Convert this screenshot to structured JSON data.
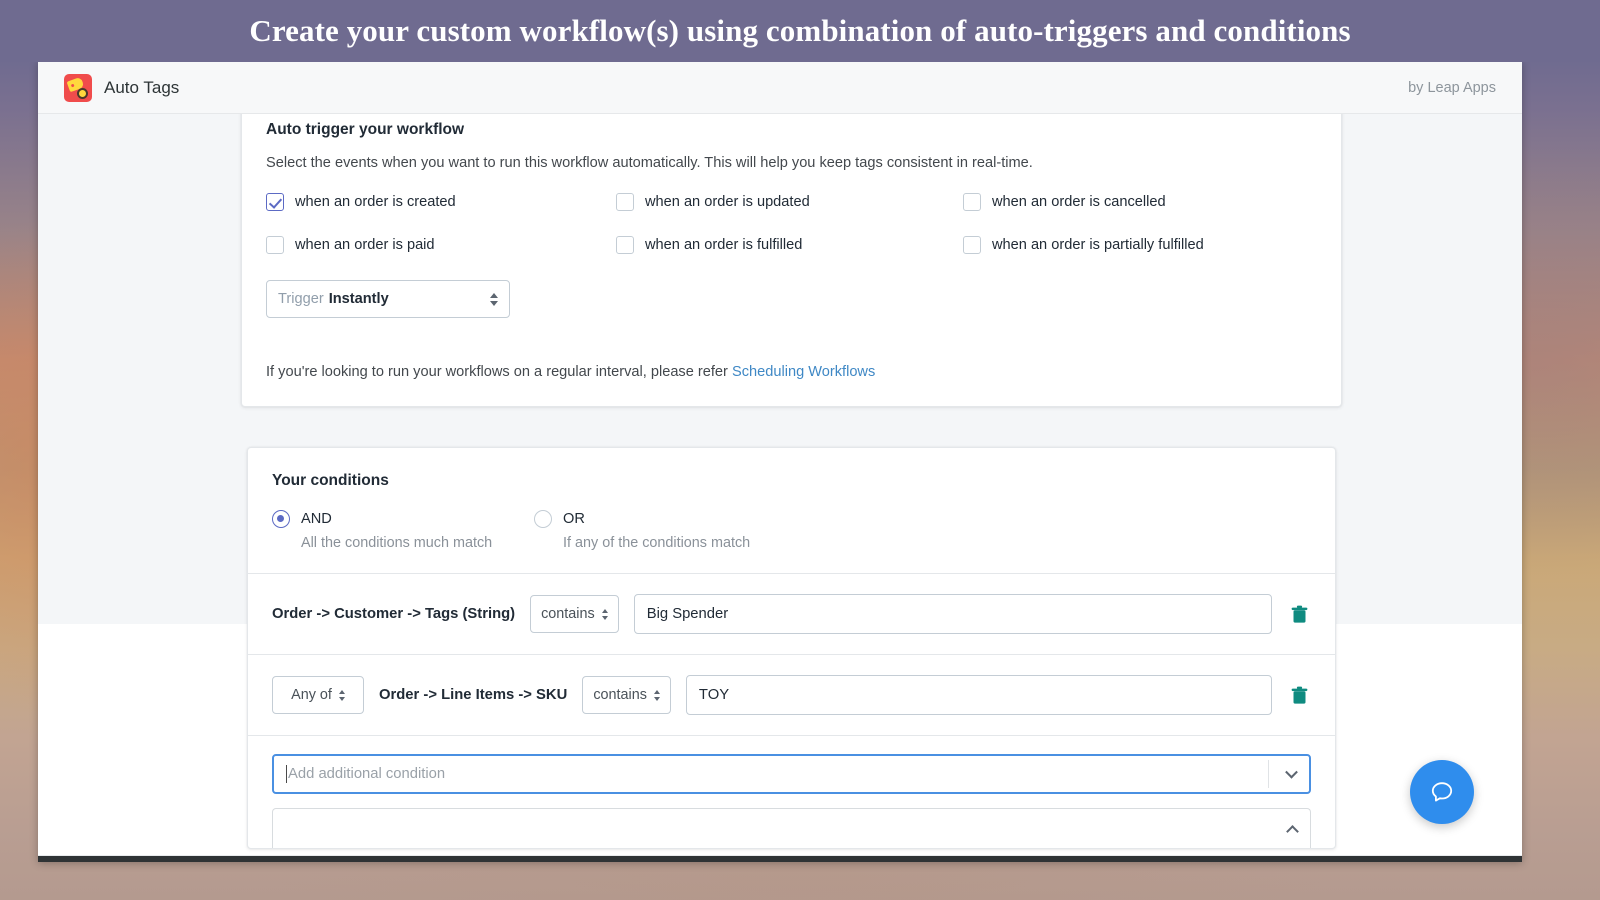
{
  "banner": {
    "title": "Create your custom workflow(s) using combination of auto-triggers and conditions",
    "bg_color": "#6f6b90"
  },
  "appbar": {
    "brand_name": "Auto Tags",
    "logo_icon": "tag-gear-logo-icon",
    "byline": "by Leap Apps"
  },
  "trigger_card": {
    "title": "Auto trigger your workflow",
    "description": "Select the events when you want to run this workflow automatically. This will help you keep tags consistent in real-time.",
    "events": [
      {
        "label": "when an order is created",
        "checked": true
      },
      {
        "label": "when an order is updated",
        "checked": false
      },
      {
        "label": "when an order is cancelled",
        "checked": false
      },
      {
        "label": "when an order is paid",
        "checked": false
      },
      {
        "label": "when an order is fulfilled",
        "checked": false
      },
      {
        "label": "when an order is partially fulfilled",
        "checked": false
      }
    ],
    "trigger_select": {
      "prefix": "Trigger",
      "value": "Instantly"
    },
    "footer_note": {
      "text": "If you're looking to run your workflows on a regular interval, please refer ",
      "link_label": "Scheduling Workflows",
      "link_color": "#3f88c5"
    }
  },
  "conditions_card": {
    "title": "Your conditions",
    "match_options": [
      {
        "label": "AND",
        "sub": "All the conditions much match",
        "selected": true
      },
      {
        "label": "OR",
        "sub": "If any of the conditions match",
        "selected": false
      }
    ],
    "rows": [
      {
        "quantifier": null,
        "path": "Order -> Customer -> Tags (String)",
        "operator": "contains",
        "value": "Big Spender",
        "delete_icon": "trash-icon"
      },
      {
        "quantifier": "Any of",
        "path": "Order -> Line Items -> SKU",
        "operator": "contains",
        "value": "TOY",
        "delete_icon": "trash-icon"
      }
    ],
    "add_condition": {
      "placeholder": "Add additional condition",
      "chevron_icon": "chevron-down-icon",
      "focused": true,
      "focus_color": "#4a90e2"
    },
    "open_panel_chevron_icon": "chevron-up-icon"
  },
  "chat_widget": {
    "icon": "chat-bubble-icon",
    "color": "#2f8ded"
  },
  "accent_colors": {
    "selection": "#5c6ac4",
    "trash": "#0f8b80",
    "link": "#3f88c5"
  }
}
